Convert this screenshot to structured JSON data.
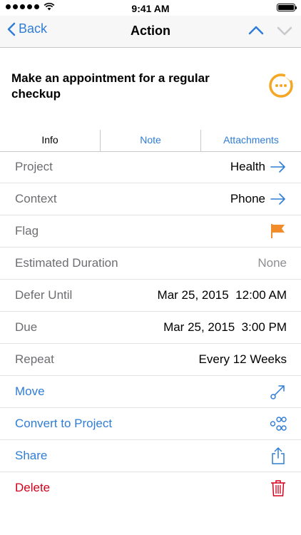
{
  "status_bar": {
    "time": "9:41 AM"
  },
  "nav": {
    "back_label": "Back",
    "title": "Action"
  },
  "task": {
    "title": "Make an appointment for a regular checkup"
  },
  "tabs": [
    {
      "label": "Info",
      "active": true
    },
    {
      "label": "Note",
      "active": false
    },
    {
      "label": "Attachments",
      "active": false
    }
  ],
  "fields": {
    "project": {
      "label": "Project",
      "value": "Health"
    },
    "context": {
      "label": "Context",
      "value": "Phone"
    },
    "flag": {
      "label": "Flag",
      "flagged": true,
      "color": "#f08c2a"
    },
    "duration": {
      "label": "Estimated Duration",
      "value": "None"
    },
    "defer": {
      "label": "Defer Until",
      "value": "Mar 25, 2015  12:00 AM"
    },
    "due": {
      "label": "Due",
      "value": "Mar 25, 2015  3:00 PM"
    },
    "repeat": {
      "label": "Repeat",
      "value": "Every 12 Weeks"
    }
  },
  "actions": {
    "move": {
      "label": "Move",
      "icon": "move-icon"
    },
    "convert": {
      "label": "Convert to Project",
      "icon": "project-icon"
    },
    "share": {
      "label": "Share",
      "icon": "share-icon"
    },
    "delete": {
      "label": "Delete",
      "icon": "trash-icon"
    }
  },
  "colors": {
    "accent": "#2f7dd6",
    "danger": "#d0021b",
    "flag": "#f08c2a",
    "status_ring": "#f5a623"
  }
}
